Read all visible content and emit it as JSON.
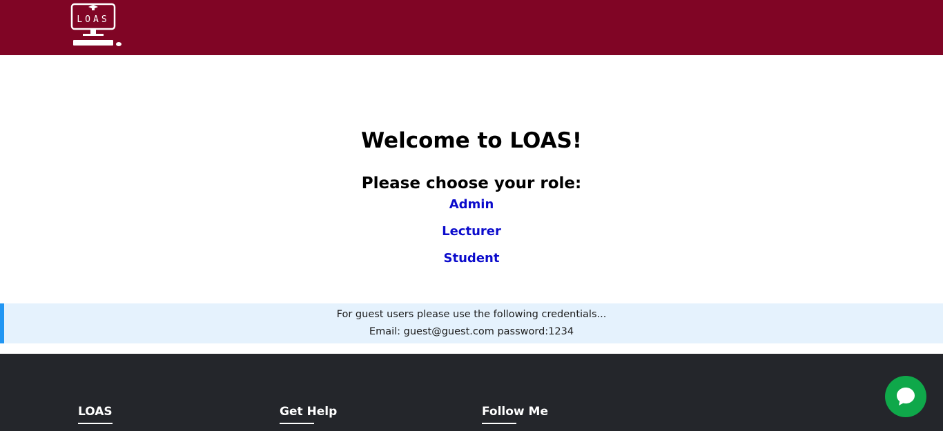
{
  "header": {
    "logo_text": "LOAS",
    "brand_color": "#800525"
  },
  "main": {
    "welcome": "Welcome to LOAS!",
    "choose_role": "Please choose your role:",
    "roles": [
      {
        "label": "Admin"
      },
      {
        "label": "Lecturer"
      },
      {
        "label": "Student"
      }
    ],
    "link_color": "#0b0bcc"
  },
  "notice": {
    "line1": "For guest users please use the following credentials...",
    "line2": "Email: guest@guest.com password:1234",
    "accent_color": "#2196f3"
  },
  "footer": {
    "columns": [
      {
        "title": "LOAS"
      },
      {
        "title": "Get Help"
      },
      {
        "title": "Follow Me"
      }
    ],
    "background": "#24262b"
  },
  "chat": {
    "icon": "chat-bubble-icon",
    "color": "#0fa84a"
  }
}
